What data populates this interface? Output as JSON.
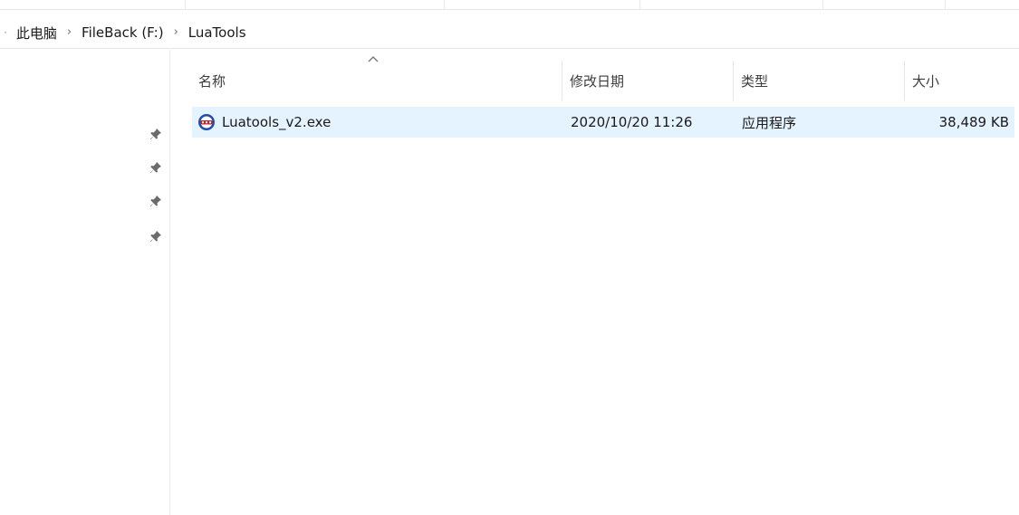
{
  "breadcrumb": {
    "items": [
      "此电脑",
      "FileBack (F:)",
      "LuaTools"
    ],
    "separator": "›"
  },
  "columns": {
    "name": "名称",
    "modified": "修改日期",
    "type": "类型",
    "size": "大小"
  },
  "files": [
    {
      "name": "Luatools_v2.exe",
      "modified": "2020/10/20 11:26",
      "type": "应用程序",
      "size": "38,489 KB",
      "icon": "luatools-app-icon"
    }
  ],
  "colors": {
    "selection": "#e5f3ff",
    "divider": "#e5e5e5",
    "icon_blue": "#1e4fa8",
    "icon_red": "#c8242b"
  }
}
